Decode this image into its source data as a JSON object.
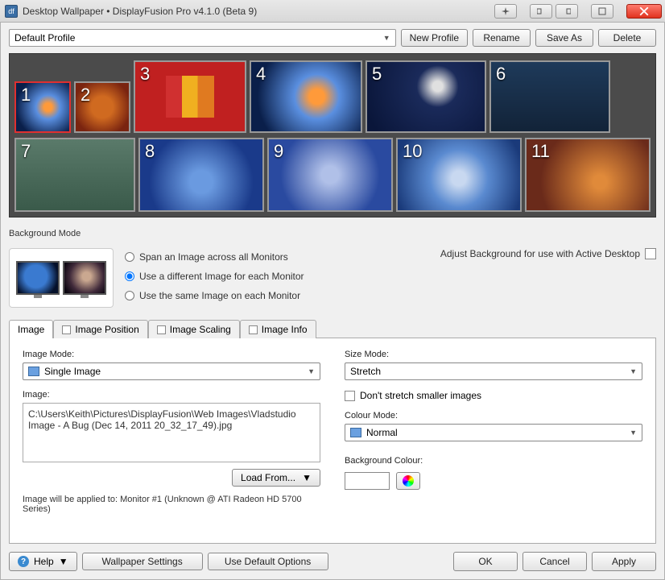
{
  "window": {
    "title": "Desktop Wallpaper • DisplayFusion Pro v4.1.0 (Beta 9)"
  },
  "profile": {
    "selected": "Default Profile",
    "buttons": {
      "new": "New Profile",
      "rename": "Rename",
      "saveas": "Save As",
      "delete": "Delete"
    }
  },
  "monitors": [
    "1",
    "2",
    "3",
    "4",
    "5",
    "6",
    "7",
    "8",
    "9",
    "10",
    "11"
  ],
  "bgmode": {
    "label": "Background Mode",
    "options": {
      "span": "Span an Image across all Monitors",
      "diff": "Use a different Image for each Monitor",
      "same": "Use the same Image on each Monitor"
    },
    "active_desktop": "Adjust Background for use with Active Desktop"
  },
  "tabs": {
    "image": "Image",
    "position": "Image Position",
    "scaling": "Image Scaling",
    "info": "Image Info"
  },
  "image_tab": {
    "image_mode_label": "Image Mode:",
    "image_mode_value": "Single Image",
    "image_label": "Image:",
    "image_path": "C:\\Users\\Keith\\Pictures\\DisplayFusion\\Web Images\\Vladstudio Image - A Bug (Dec 14, 2011 20_32_17_49).jpg",
    "load_from": "Load From...",
    "applied_note": "Image will be applied to: Monitor #1 (Unknown @ ATI Radeon HD 5700 Series)",
    "size_mode_label": "Size Mode:",
    "size_mode_value": "Stretch",
    "dont_stretch": "Don't stretch smaller images",
    "colour_mode_label": "Colour Mode:",
    "colour_mode_value": "Normal",
    "bg_colour_label": "Background Colour:"
  },
  "footer": {
    "help": "Help",
    "wallpaper_settings": "Wallpaper Settings",
    "defaults": "Use Default Options",
    "ok": "OK",
    "cancel": "Cancel",
    "apply": "Apply"
  }
}
